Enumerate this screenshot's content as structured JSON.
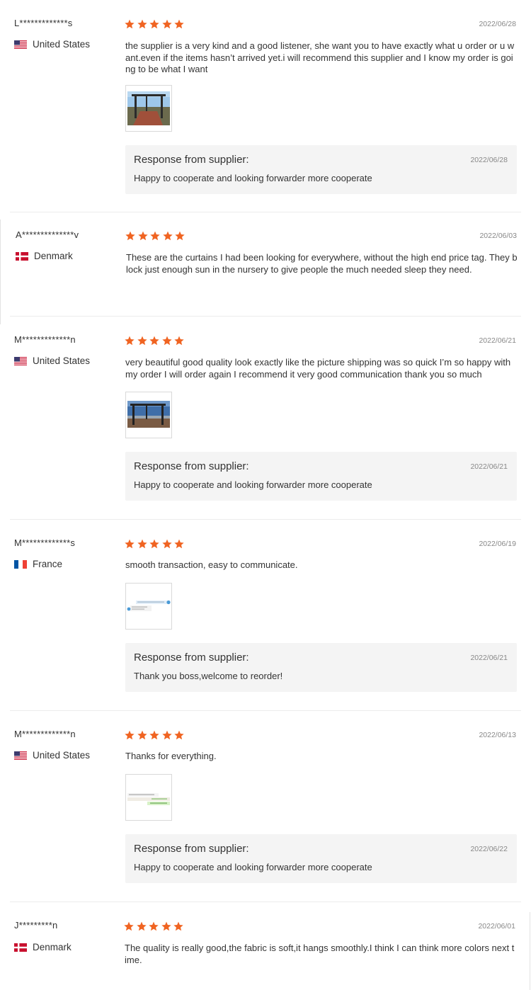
{
  "colors": {
    "star": "#f06422",
    "response_bg": "#f4f4f4",
    "date": "#888888",
    "divider": "#ececec"
  },
  "icons": {
    "rating": "star-icon",
    "country": "flag-icon"
  },
  "reviews": [
    {
      "user": "L*************s",
      "country": "United States",
      "flag": "us",
      "rating": 5,
      "date": "2022/06/28",
      "text": "the supplier is a very kind and a good listener, she want you to have exactly what u order or u want.even if the items hasn’t arrived yet.i will recommend this supplier and I know my order is going to be what I want",
      "has_image": true,
      "image_kind": "gazebo-deck",
      "response": {
        "title": "Response from supplier:",
        "date": "2022/06/28",
        "text": "Happy to cooperate and looking forwarder more cooperate"
      }
    },
    {
      "user": "A**************v",
      "country": "Denmark",
      "flag": "dk",
      "rating": 5,
      "date": "2022/06/03",
      "text": "These are the curtains I had been looking for everywhere, without the high end price tag. They block just enough sun in the nursery to give people the much needed sleep they need.",
      "has_image": false
    },
    {
      "user": "M*************n",
      "country": "United States",
      "flag": "us",
      "rating": 5,
      "date": "2022/06/21",
      "text": "very beautiful good quality look exactly like the picture shipping was so quick I’m so happy with my order I will order again I recommend it very good communication thank you so much",
      "has_image": true,
      "image_kind": "gazebo-sky",
      "response": {
        "title": "Response from supplier:",
        "date": "2022/06/21",
        "text": "Happy to cooperate and looking forwarder more cooperate"
      }
    },
    {
      "user": "M*************s",
      "country": "France",
      "flag": "fr",
      "rating": 5,
      "date": "2022/06/19",
      "text": "smooth transaction, easy to communicate.",
      "has_image": true,
      "image_kind": "chat-blue",
      "response": {
        "title": "Response from supplier:",
        "date": "2022/06/21",
        "text": "Thank you boss,welcome to reorder!"
      }
    },
    {
      "user": "M*************n",
      "country": "United States",
      "flag": "us",
      "rating": 5,
      "date": "2022/06/13",
      "text": "Thanks for everything.",
      "has_image": true,
      "image_kind": "chat-green",
      "response": {
        "title": "Response from supplier:",
        "date": "2022/06/22",
        "text": "Happy to cooperate and looking forwarder more cooperate"
      }
    },
    {
      "user": "J*********n",
      "country": "Denmark",
      "flag": "dk",
      "rating": 5,
      "date": "2022/06/01",
      "text": "The quality is really good,the fabric is soft,it hangs smoothly.I think I can think more colors next time.",
      "has_image": false
    }
  ]
}
